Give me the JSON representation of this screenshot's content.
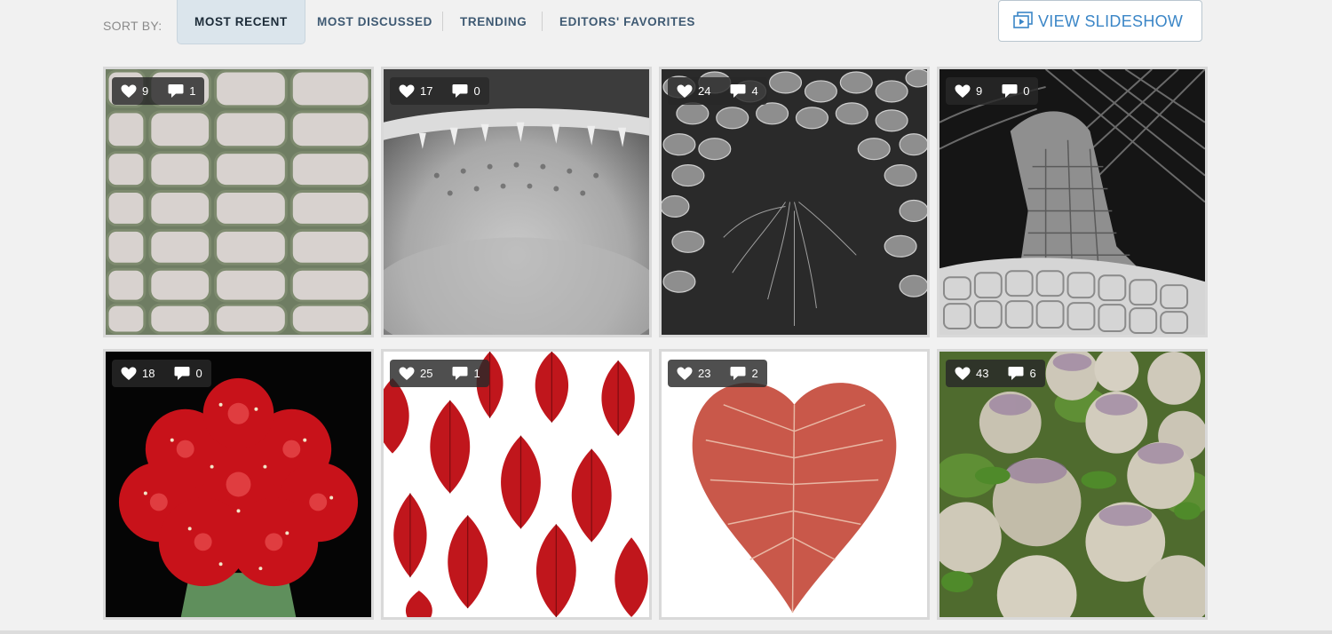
{
  "sort": {
    "label": "SORT BY:",
    "options": [
      {
        "label": "MOST RECENT",
        "active": true
      },
      {
        "label": "MOST DISCUSSED",
        "active": false
      },
      {
        "label": "TRENDING",
        "active": false
      },
      {
        "label": "EDITORS' FAVORITES",
        "active": false
      }
    ]
  },
  "slideshow": {
    "label": "VIEW SLIDESHOW",
    "icon": "slideshow-icon",
    "color": "#3b86c7"
  },
  "tiles": [
    {
      "likes": "9",
      "comments": "1",
      "subject": "crocodile-skin-scales"
    },
    {
      "likes": "17",
      "comments": "0",
      "subject": "reptile-mouth-closeup"
    },
    {
      "likes": "24",
      "comments": "4",
      "subject": "sea-anemone-scales"
    },
    {
      "likes": "9",
      "comments": "0",
      "subject": "crocodile-head"
    },
    {
      "likes": "18",
      "comments": "0",
      "subject": "red-cactus"
    },
    {
      "likes": "25",
      "comments": "1",
      "subject": "red-leaves-pattern"
    },
    {
      "likes": "23",
      "comments": "2",
      "subject": "heart-shaped-leaf"
    },
    {
      "likes": "43",
      "comments": "6",
      "subject": "turnips"
    }
  ],
  "icons": {
    "like": "heart-icon",
    "comment": "comment-icon"
  }
}
